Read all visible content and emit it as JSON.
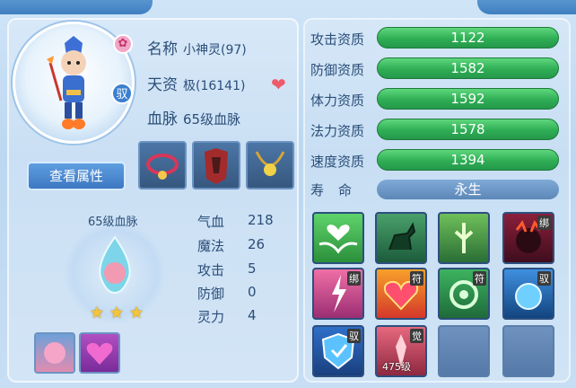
{
  "header": {
    "left_title": "",
    "right_title": ""
  },
  "pet": {
    "name_label": "名称",
    "name_value": "小神灵(97)",
    "talent_label": "天资",
    "talent_value": "极(16141)",
    "bloodline_label": "血脉",
    "bloodline_value": "65级血脉",
    "ride_badge": "驭",
    "attr_button": "查看属性"
  },
  "bloodline_card": {
    "title": "65级血脉",
    "stars": 3
  },
  "base_stats": [
    {
      "label": "气血",
      "value": "218"
    },
    {
      "label": "魔法",
      "value": "26"
    },
    {
      "label": "攻击",
      "value": "5"
    },
    {
      "label": "防御",
      "value": "0"
    },
    {
      "label": "灵力",
      "value": "4"
    }
  ],
  "aptitudes": [
    {
      "label": "攻击资质",
      "value": "1122"
    },
    {
      "label": "防御资质",
      "value": "1582"
    },
    {
      "label": "体力资质",
      "value": "1592"
    },
    {
      "label": "法力资质",
      "value": "1578"
    },
    {
      "label": "速度资质",
      "value": "1394"
    }
  ],
  "life": {
    "label": "寿命",
    "value": "永生"
  },
  "skill_tags": {
    "bind": "绑",
    "charm": "符",
    "ride": "驭",
    "awaken": "觉"
  },
  "skill_level_text": "475级",
  "colors": {
    "aptitude_bar": "#2fae55",
    "button": "#3d78c2",
    "panel_border": "#ffffff"
  }
}
